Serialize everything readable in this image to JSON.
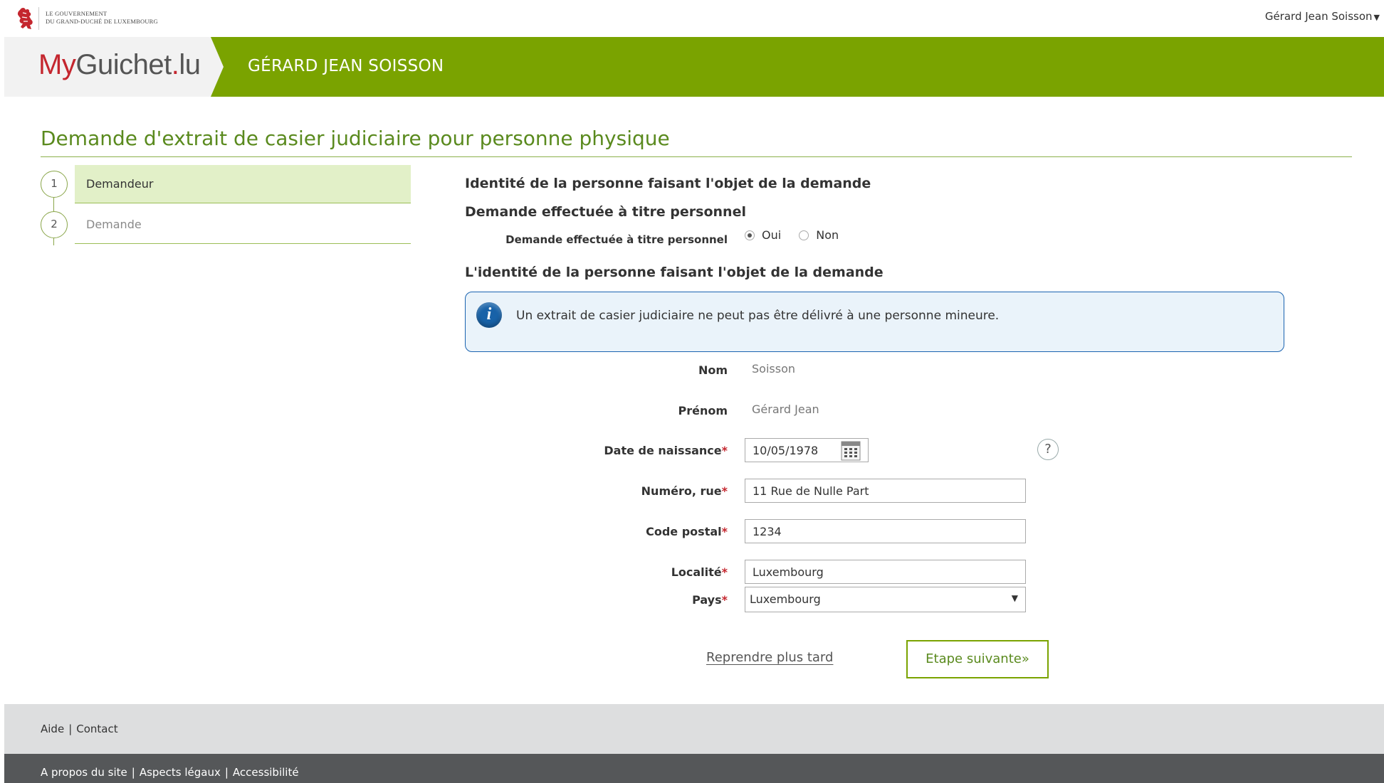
{
  "gov": {
    "line1": "Le Gouvernement",
    "line2": "du Grand-Duché de Luxembourg"
  },
  "user_menu": {
    "name": "Gérard Jean Soisson"
  },
  "header": {
    "brand_my": "My",
    "brand_guichet": "Guichet",
    "brand_dot": ".",
    "brand_lu": "lu",
    "user": "GÉRARD JEAN SOISSON"
  },
  "page_title": "Demande d'extrait de casier judiciaire pour personne physique",
  "steps": [
    {
      "number": "1",
      "label": "Demandeur"
    },
    {
      "number": "2",
      "label": "Demande"
    }
  ],
  "form": {
    "heading_identity": "Identité de la personne faisant l'objet de la demande",
    "heading_personal": "Demande effectuée à titre personnel",
    "personal_label": "Demande effectuée à titre personnel",
    "radio_yes": "Oui",
    "radio_no": "Non",
    "radio_selected": "Oui",
    "heading_identity2": "L'identité de la personne faisant l'objet de la demande",
    "info_text": "Un extrait de casier judiciaire ne peut pas être délivré à une personne mineure.",
    "nom_label": "Nom",
    "nom_value": "Soisson",
    "prenom_label": "Prénom",
    "prenom_value": "Gérard Jean",
    "date_label": "Date de naissance",
    "date_value": "10/05/1978",
    "help": "?",
    "street_label": "Numéro, rue",
    "street_value": "11 Rue de Nulle Part",
    "postal_label": "Code postal",
    "postal_value": "1234",
    "city_label": "Localité",
    "city_value": "Luxembourg",
    "country_label": "Pays",
    "country_value": "Luxembourg",
    "required_mark": "*"
  },
  "actions": {
    "later": "Reprendre plus tard",
    "next": "Etape suivante»"
  },
  "footer": {
    "help": "Aide",
    "contact": "Contact",
    "about": "A propos du site",
    "legal": "Aspects légaux",
    "accessibility": "Accessibilité",
    "separator": "|"
  },
  "colors": {
    "brand_green": "#7aa300",
    "title_green": "#5a8a1e",
    "required_red": "#c4262e",
    "info_blue": "#1862a8"
  }
}
